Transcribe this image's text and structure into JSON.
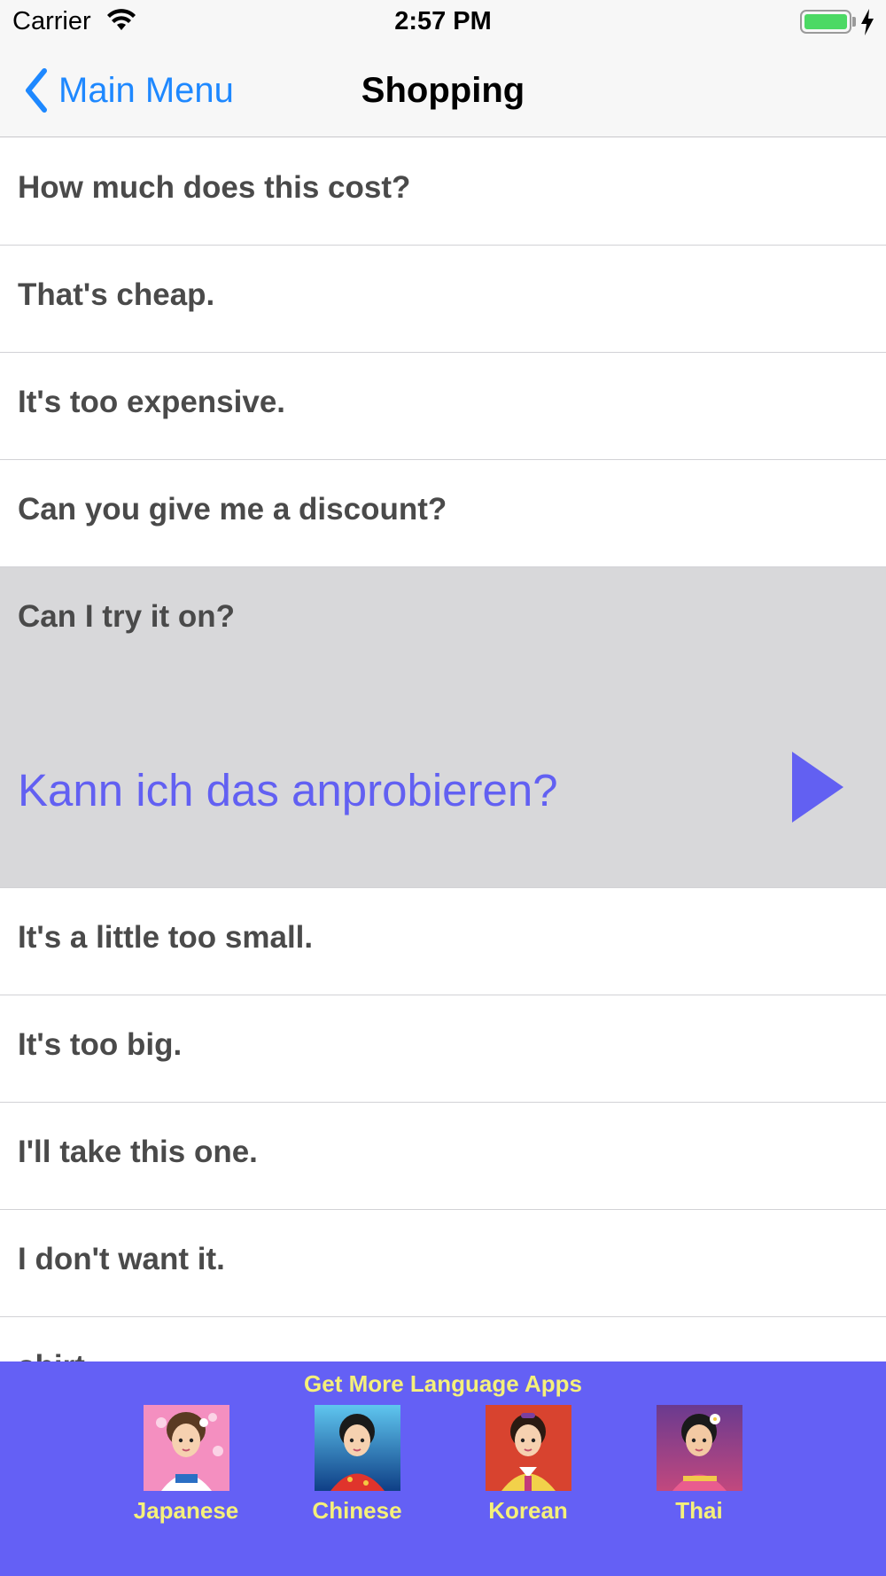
{
  "status_bar": {
    "carrier": "Carrier",
    "time": "2:57 PM",
    "battery_level": 1.0
  },
  "nav": {
    "back_label": "Main Menu",
    "title": "Shopping"
  },
  "phrases": [
    {
      "text": "How much does this cost?"
    },
    {
      "text": "That's cheap."
    },
    {
      "text": "It's too expensive."
    },
    {
      "text": "Can you give me a discount?"
    },
    {
      "text": "Can I try it on?",
      "translation": "Kann ich das anprobieren?",
      "expanded": true
    },
    {
      "text": "It's a little too small."
    },
    {
      "text": "It's too big."
    },
    {
      "text": "I'll take this one."
    },
    {
      "text": "I don't want it."
    },
    {
      "text": "shirt"
    }
  ],
  "promo": {
    "title": "Get More Language Apps",
    "apps": [
      {
        "label": "Japanese",
        "icon": "japanese-girl-avatar",
        "bg": "#f48fc0"
      },
      {
        "label": "Chinese",
        "icon": "chinese-girl-avatar",
        "bg": "#1b6fb4"
      },
      {
        "label": "Korean",
        "icon": "korean-girl-avatar",
        "bg": "#d8432f"
      },
      {
        "label": "Thai",
        "icon": "thai-girl-avatar",
        "bg": "#9b3f8f"
      }
    ]
  },
  "colors": {
    "accent_blue": "#1e88ff",
    "translation_purple": "#6260f2",
    "promo_bg": "#6460f5",
    "promo_text": "#f5f07a",
    "selected_row_bg": "#d8d8da"
  }
}
